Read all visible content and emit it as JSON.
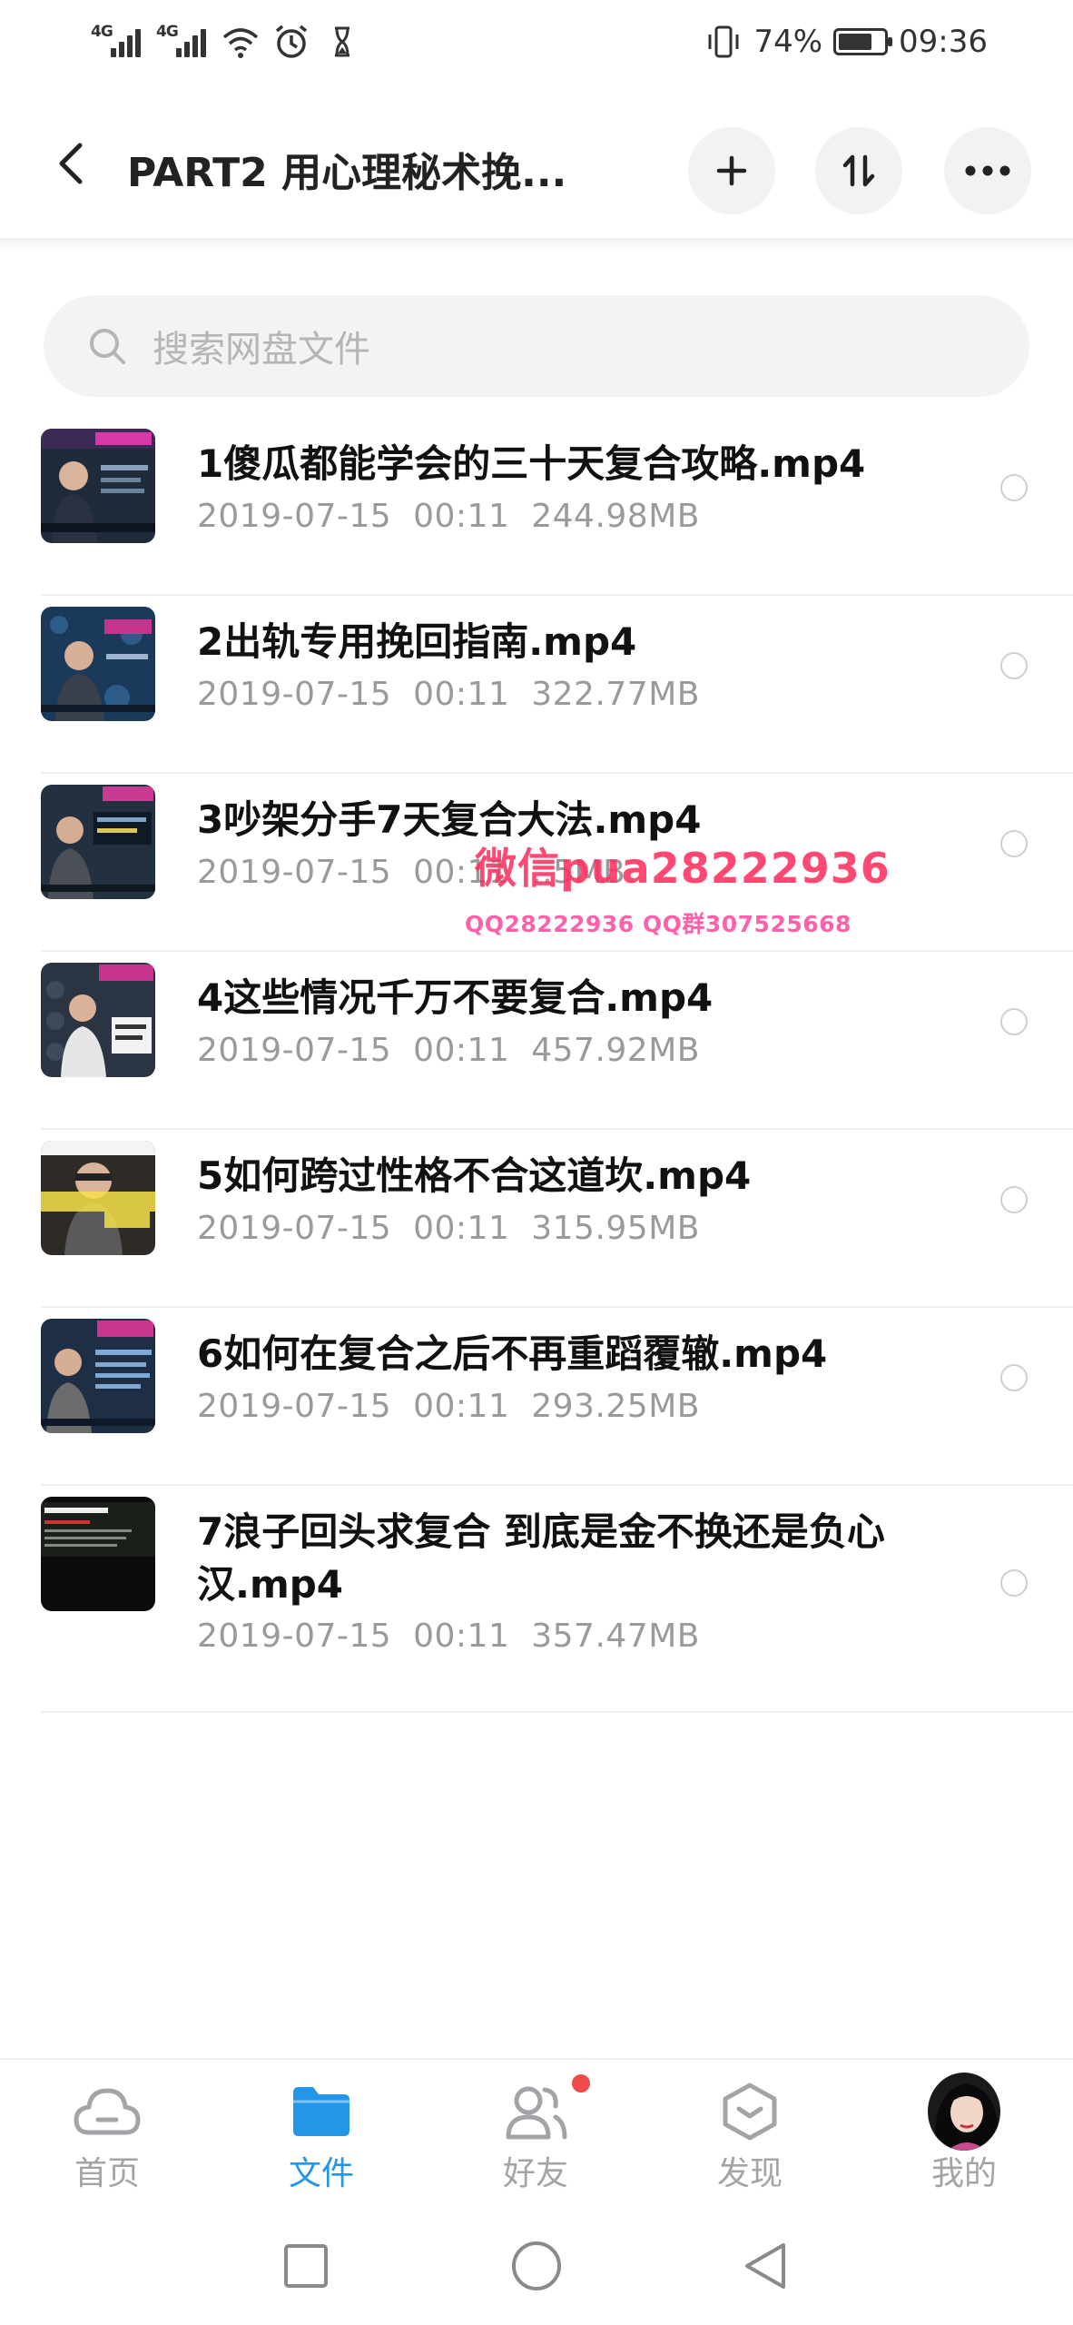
{
  "status_bar": {
    "network_1": "4G",
    "network_2": "4G",
    "battery_percent": "74%",
    "battery_level": 0.74,
    "time": "09:36",
    "icons": [
      "signal-icon",
      "signal-icon",
      "wifi-icon",
      "alarm-icon",
      "hourglass-icon",
      "vibrate-icon",
      "battery-icon"
    ]
  },
  "header": {
    "title": "PART2 用心理秘术挽...",
    "back_icon": "chevron-left-icon",
    "add_icon": "plus-icon",
    "sort_icon": "sort-icon",
    "more_icon": "more-icon"
  },
  "search": {
    "placeholder": "搜索网盘文件"
  },
  "files": [
    {
      "name": "1傻瓜都能学会的三十天复合攻略.mp4",
      "date": "2019-07-15",
      "time": "00:11",
      "size": "244.98MB"
    },
    {
      "name": "2出轨专用挽回指南.mp4",
      "date": "2019-07-15",
      "time": "00:11",
      "size": "322.77MB"
    },
    {
      "name": "3吵架分手7天复合大法.mp4",
      "date": "2019-07-15",
      "time": "00:11",
      "size": "..5MB"
    },
    {
      "name": "4这些情况千万不要复合.mp4",
      "date": "2019-07-15",
      "time": "00:11",
      "size": "457.92MB"
    },
    {
      "name": "5如何跨过性格不合这道坎.mp4",
      "date": "2019-07-15",
      "time": "00:11",
      "size": "315.95MB"
    },
    {
      "name": "6如何在复合之后不再重蹈覆辙.mp4",
      "date": "2019-07-15",
      "time": "00:11",
      "size": "293.25MB"
    },
    {
      "name": "7浪子回头求复合 到底是金不换还是负心汉.mp4",
      "date": "2019-07-15",
      "time": "00:11",
      "size": "357.47MB"
    }
  ],
  "watermark": {
    "line1": "微信pua28222936",
    "line2": "QQ28222936 QQ群307525668"
  },
  "bottom_nav": {
    "items": [
      {
        "label": "首页",
        "icon": "cloud-icon",
        "active": false
      },
      {
        "label": "文件",
        "icon": "folder-icon",
        "active": true
      },
      {
        "label": "好友",
        "icon": "friends-icon",
        "active": false
      },
      {
        "label": "发现",
        "icon": "discover-icon",
        "active": false
      },
      {
        "label": "我的",
        "icon": "avatar",
        "active": false
      }
    ]
  },
  "colors": {
    "accent": "#2396e8",
    "badge": "#f04a4a",
    "watermark": "#ff2f5f",
    "text_primary": "#111111",
    "text_secondary": "#9a9a9e"
  }
}
